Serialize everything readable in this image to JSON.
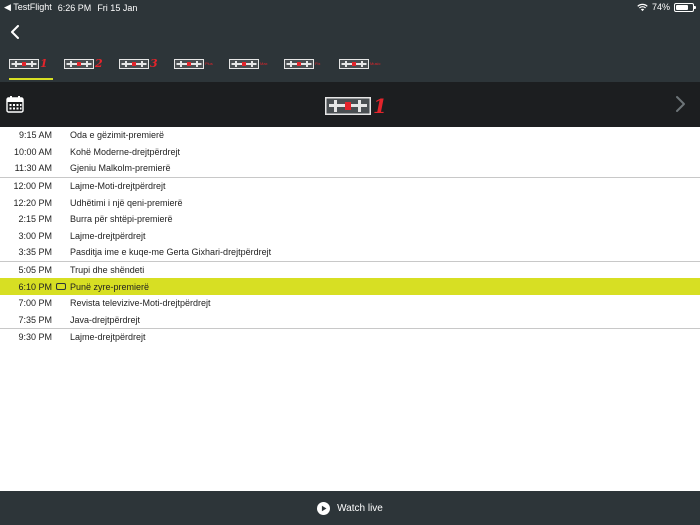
{
  "status_bar": {
    "back_app": "◀ TestFlight",
    "time": "6:26 PM",
    "date": "Fri 15 Jan",
    "battery": "74%",
    "battery_level": 0.74
  },
  "channel_tabs": [
    {
      "num": "1",
      "small": ""
    },
    {
      "num": "2",
      "small": ""
    },
    {
      "num": "3",
      "small": ""
    },
    {
      "num": "",
      "small": "Plus"
    },
    {
      "num": "",
      "small": "Max"
    },
    {
      "num": "",
      "small": "Fix"
    },
    {
      "num": "",
      "small": "Music"
    }
  ],
  "channel_header": {
    "logo_num": "1"
  },
  "schedule": {
    "groups": [
      [
        {
          "time": "9:15 AM",
          "title": "Oda e gëzimit-premierë"
        },
        {
          "time": "10:00 AM",
          "title": "Kohë Moderne-drejtpërdrejt"
        },
        {
          "time": "11:30 AM",
          "title": "Gjeniu Malkolm-premierë"
        }
      ],
      [
        {
          "time": "12:00 PM",
          "title": "Lajme-Moti-drejtpërdrejt"
        },
        {
          "time": "12:20 PM",
          "title": "Udhëtimi i një qeni-premierë"
        },
        {
          "time": "2:15 PM",
          "title": "Burra për shtëpi-premierë"
        },
        {
          "time": "3:00 PM",
          "title": "Lajme-drejtpërdrejt"
        },
        {
          "time": "3:35 PM",
          "title": "Pasditja ime e kuqe-me Gerta Gixhari-drejtpërdrejt"
        }
      ],
      [
        {
          "time": "5:05 PM",
          "title": "Trupi dhe shëndeti"
        },
        {
          "time": "6:10 PM",
          "title": "Punë zyre-premierë",
          "current": true
        },
        {
          "time": "7:00 PM",
          "title": "Revista televizive-Moti-drejtpërdrejt"
        },
        {
          "time": "7:35 PM",
          "title": "Java-drejtpërdrejt"
        }
      ],
      [
        {
          "time": "9:30 PM",
          "title": "Lajme-drejtpërdrejt"
        }
      ]
    ]
  },
  "bottom_bar": {
    "watch_live_label": "Watch live"
  },
  "colors": {
    "bar_bg": "#2d3539",
    "header_bg": "#1c1e20",
    "accent": "#d7df23",
    "brand_red": "#e3242b"
  }
}
